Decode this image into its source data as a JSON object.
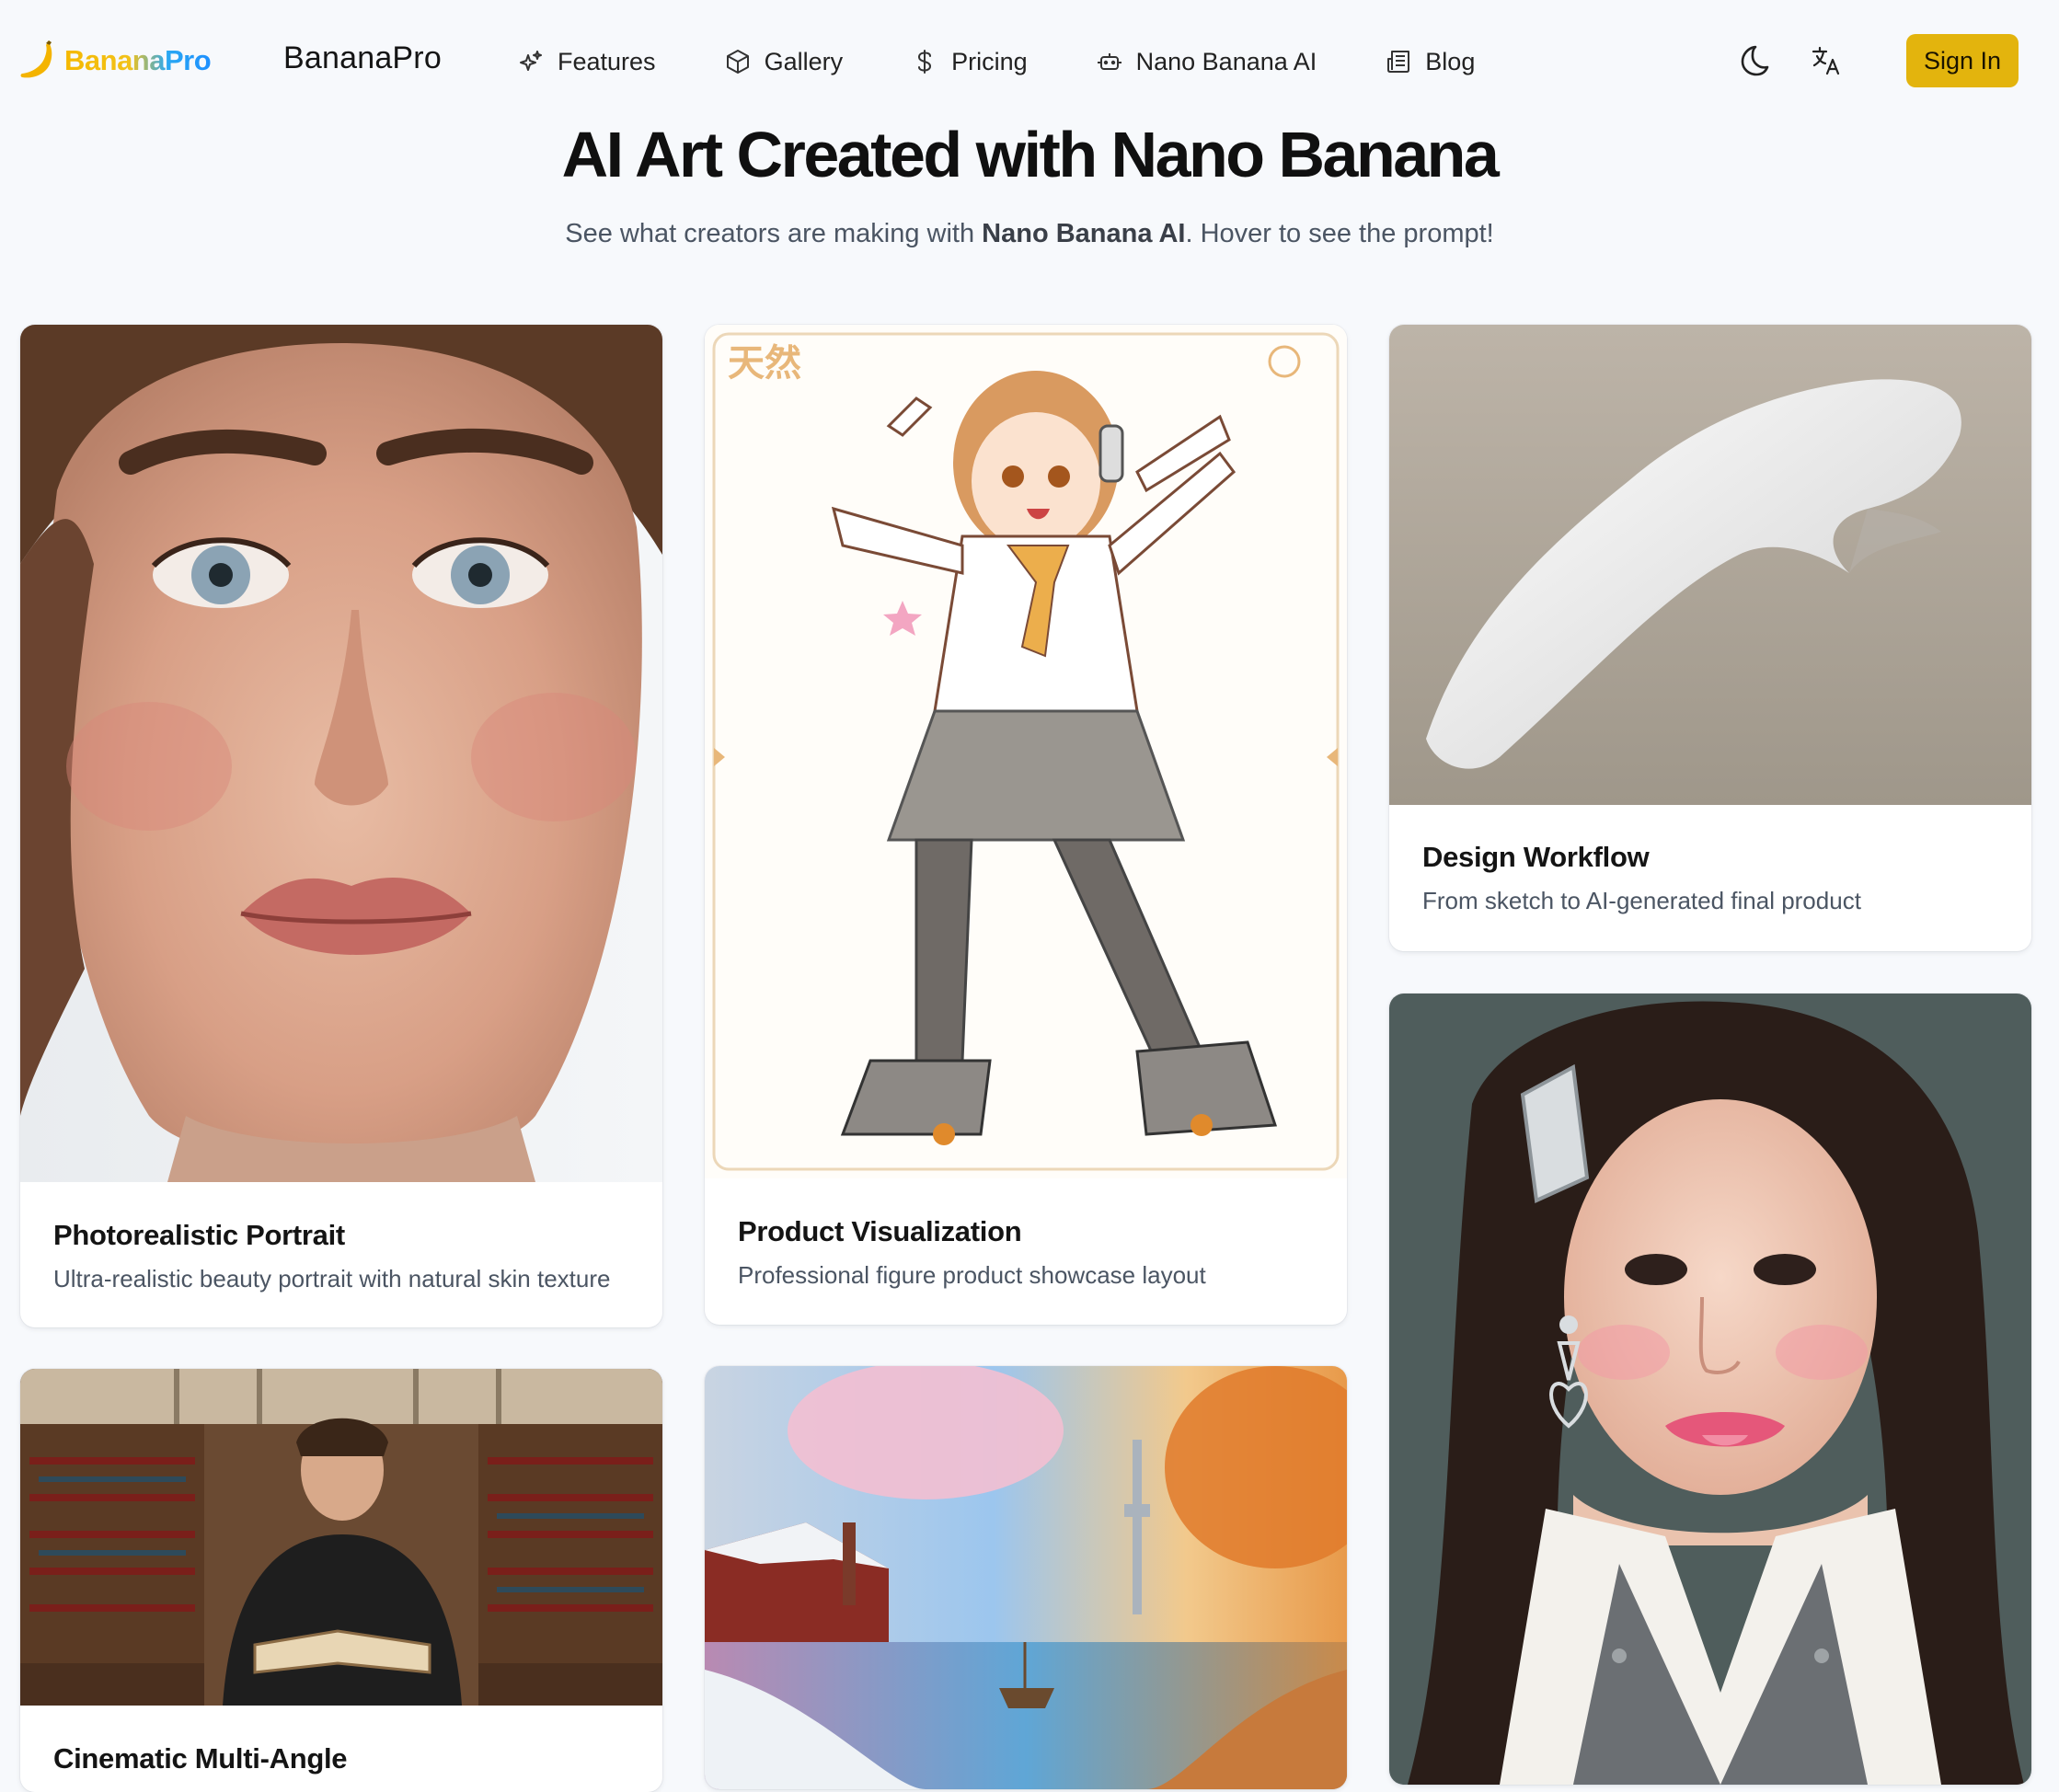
{
  "nav": {
    "logo_text": "BananaPro",
    "brand_name": "BananaPro",
    "links": [
      {
        "label": "Features",
        "icon": "sparkles-icon"
      },
      {
        "label": "Gallery",
        "icon": "cube-icon"
      },
      {
        "label": "Pricing",
        "icon": "dollar-icon"
      },
      {
        "label": "Nano Banana AI",
        "icon": "robot-icon"
      },
      {
        "label": "Blog",
        "icon": "newspaper-icon"
      }
    ],
    "theme_icon": "moon-icon",
    "language_icon": "translate-icon",
    "sign_in_label": "Sign In"
  },
  "hero": {
    "title": "AI Art Created with Nano Banana",
    "subtitle_before": "See what creators are making with ",
    "subtitle_bold": "Nano Banana AI",
    "subtitle_after": ". Hover to see the prompt!"
  },
  "gallery": {
    "cards": [
      {
        "title": "Photorealistic Portrait",
        "description": "Ultra-realistic beauty portrait with natural skin texture"
      },
      {
        "title": "Product Visualization",
        "description": "Professional figure product showcase layout"
      },
      {
        "title": "Design Workflow",
        "description": "From sketch to AI-generated final product"
      },
      {
        "title": "Cinematic Multi-Angle",
        "description": ""
      },
      {
        "title": "",
        "description": ""
      },
      {
        "title": "",
        "description": ""
      }
    ]
  },
  "colors": {
    "accent": "#e3b40d",
    "page_background": "#f7f9fc",
    "logo_gradient_start": "#f5b800",
    "logo_gradient_end": "#1e90ff"
  }
}
